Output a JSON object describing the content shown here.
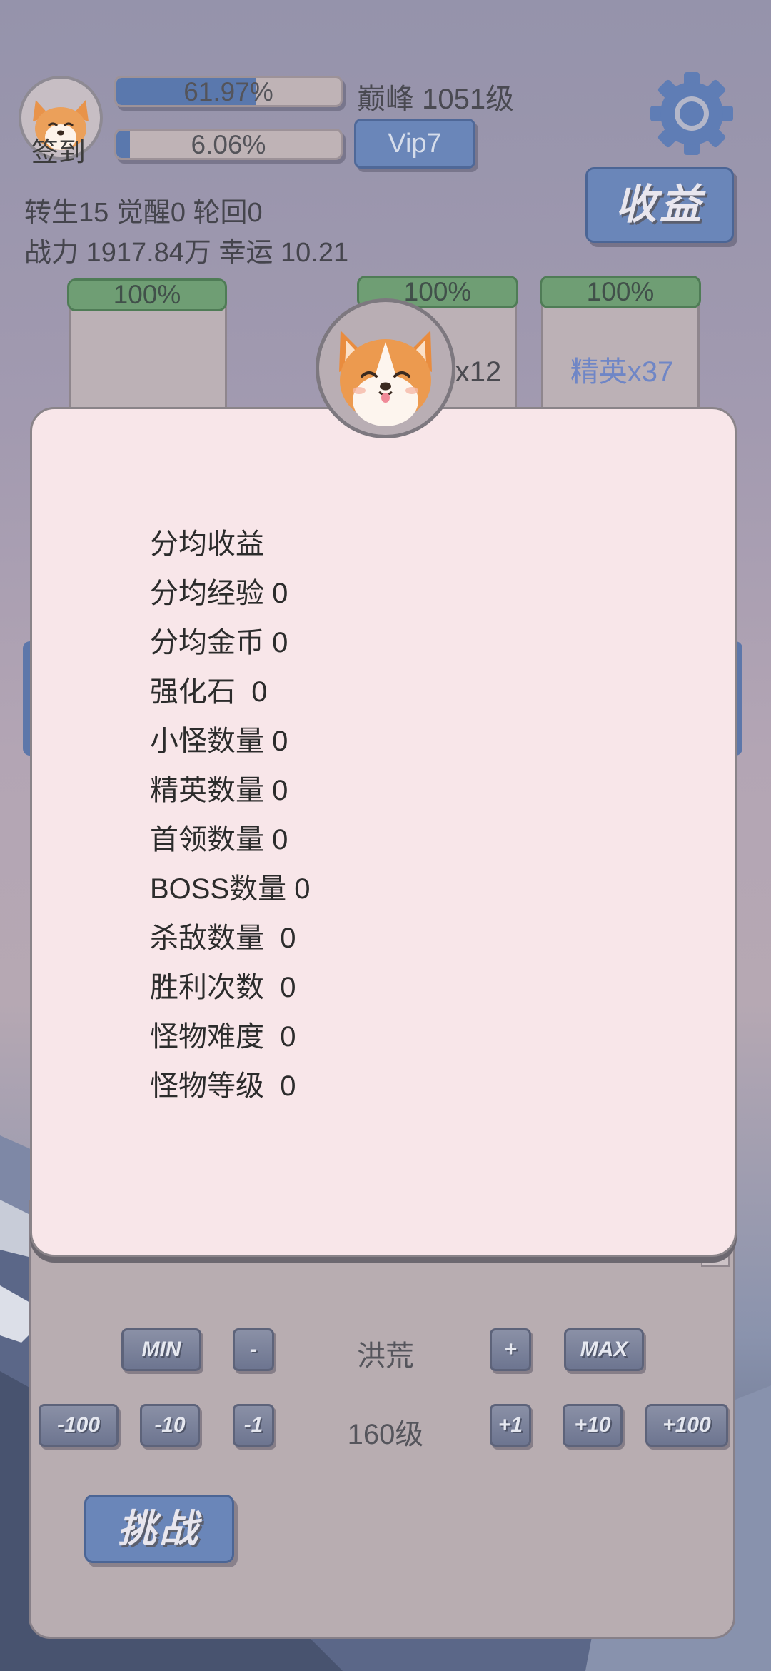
{
  "header": {
    "sign_label": "签到",
    "progress_top": {
      "text": "61.97%",
      "value": 0.6197
    },
    "progress_bottom": {
      "text": "6.06%",
      "value": 0.0606
    },
    "peak_label": "巅峰 1051级",
    "vip_label": "Vip7",
    "income_label": "收益",
    "stats_line1": "转生15 觉醒0 轮回0",
    "stats_line2": "战力 1917.84万  幸运 10.21"
  },
  "cards": [
    {
      "percent": "100%",
      "label": ""
    },
    {
      "percent": "100%",
      "label": "怪x12"
    },
    {
      "percent": "100%",
      "label": "精英x37"
    }
  ],
  "modal": {
    "rows": [
      "分均收益",
      "分均经验 0",
      "分均金币 0",
      "强化石  0",
      "小怪数量 0",
      "精英数量 0",
      "首领数量 0",
      "BOSS数量 0",
      "杀敌数量  0",
      "胜利次数  0",
      "怪物难度  0",
      "怪物等级  0"
    ]
  },
  "controls": {
    "min_label": "MIN",
    "minus_label": "-",
    "area_label": "洪荒",
    "plus_label": "+",
    "max_label": "MAX",
    "m100_label": "-100",
    "m10_label": "-10",
    "m1_label": "-1",
    "level_label": "160级",
    "p1_label": "+1",
    "p10_label": "+10",
    "p100_label": "+100",
    "challenge_label": "挑战"
  },
  "colors": {
    "accent_blue": "#6a86b9",
    "progress_green": "#6f9e74",
    "modal_bg": "#f8e6e9",
    "elite_text": "#6f86c6"
  }
}
